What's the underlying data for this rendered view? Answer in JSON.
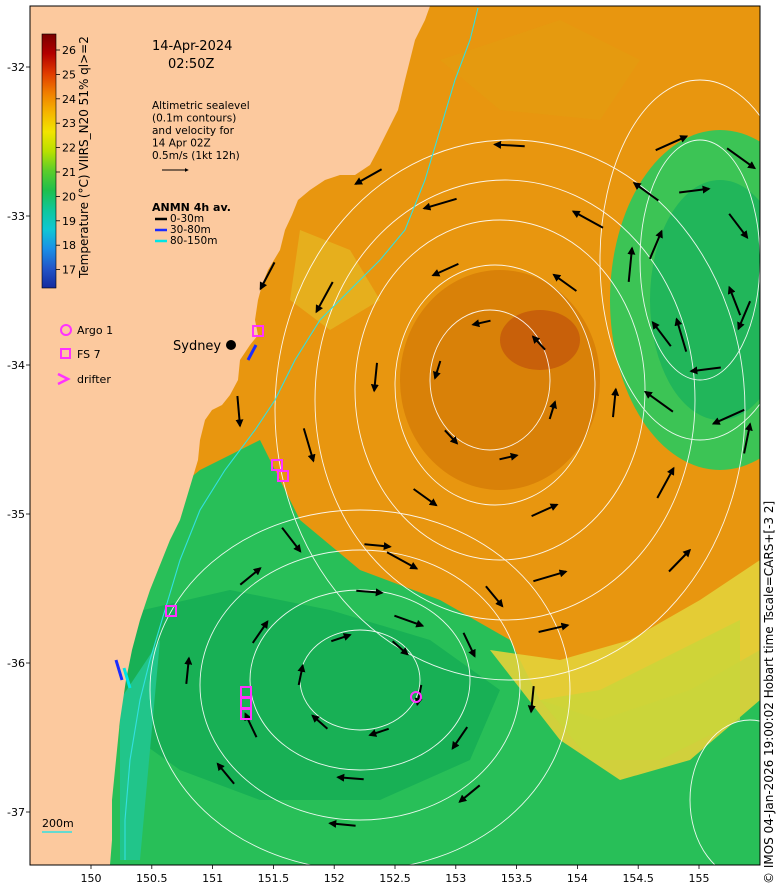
{
  "header": {
    "date": "14-Apr-2024",
    "time": "02:50Z",
    "note_lines": [
      "Altimetric sealevel",
      "(0.1m contours)",
      "and velocity for",
      "14 Apr 02Z",
      "0.5m/s (1kt 12h)"
    ]
  },
  "colorbar": {
    "label": "Temperature (°C) VIIRS_N20 51% ql>=2",
    "ticks": [
      "26",
      "25",
      "24",
      "23",
      "22",
      "21",
      "20",
      "19",
      "18",
      "17"
    ],
    "colors": [
      "#7a0000",
      "#b30000",
      "#e03a00",
      "#f07d00",
      "#f5b400",
      "#f2e400",
      "#b9e000",
      "#5ccd2a",
      "#1fbf4c",
      "#10c79a",
      "#0fc7d4",
      "#1a8fe6",
      "#2255c8",
      "#142a9e"
    ]
  },
  "anmn": {
    "title": "ANMN 4h av.",
    "items": [
      {
        "label": "0-30m",
        "color": "#000000"
      },
      {
        "label": "30-80m",
        "color": "#1a2cff"
      },
      {
        "label": "80-150m",
        "color": "#00e5e5"
      }
    ]
  },
  "legend": {
    "items": [
      {
        "label": "Argo 1",
        "symbol": "circle-icon",
        "color": "#ff33ff"
      },
      {
        "label": "FS 7",
        "symbol": "square-icon",
        "color": "#ff33ff"
      },
      {
        "label": "drifter",
        "symbol": "chevron-icon",
        "color": "#ff33ff"
      }
    ]
  },
  "place": {
    "name": "Sydney"
  },
  "axes": {
    "lon_ticks": [
      "150",
      "150.5",
      "151",
      "151.5",
      "152",
      "152.5",
      "153",
      "153.5",
      "154",
      "154.5",
      "155"
    ],
    "lat_ticks": [
      "-32",
      "-33",
      "-34",
      "-35",
      "-36",
      "-37"
    ]
  },
  "scale": {
    "label": "200m"
  },
  "credit": "© IMOS 04-Jan-2026 19:00:02 Hobart time Tscale=CARS+[-3 2]",
  "colors": {
    "land": "#fcc99e",
    "warm": "#e4900e",
    "cool": "#22c25a",
    "marker": "#ff33ff"
  }
}
